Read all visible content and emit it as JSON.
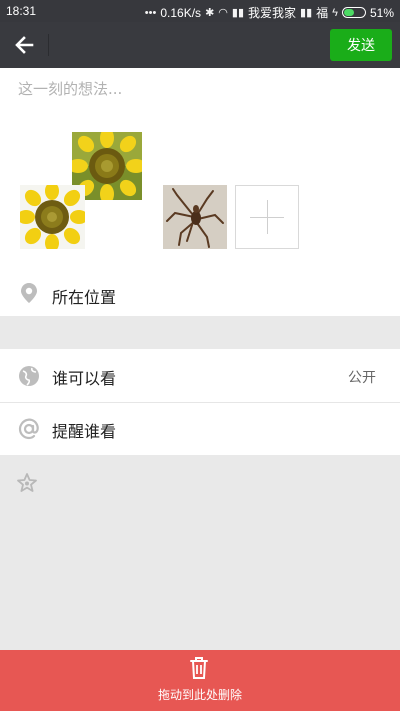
{
  "status_bar": {
    "time": "18:31",
    "net_speed": "0.16K/s",
    "carrier": "我爱我家",
    "fortune": "福",
    "battery": "51%",
    "battery_level": 0.51
  },
  "header": {
    "send_label": "发送"
  },
  "composer": {
    "placeholder": "这一刻的想法..."
  },
  "photos": {
    "items": [
      "sunflower",
      "sunflower",
      "spider"
    ]
  },
  "location": {
    "label": "所在位置"
  },
  "options": {
    "visibility_label": "谁可以看",
    "visibility_value": "公开",
    "remind_label": "提醒谁看"
  },
  "delete_zone": {
    "label": "拖动到此处删除"
  },
  "colors": {
    "brand_green": "#1aad19",
    "delete_red": "#e75753",
    "header_dark": "#393a3f"
  }
}
